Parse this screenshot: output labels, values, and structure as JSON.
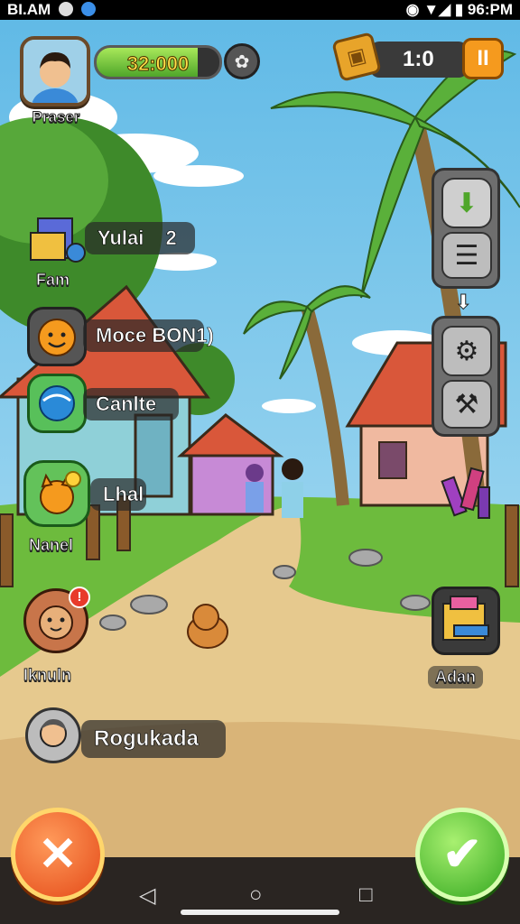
{
  "status_bar": {
    "left_text": "BI.AM",
    "right_text": "96:PM"
  },
  "hud": {
    "player_name": "Praser",
    "coins": "32:000",
    "coin_progress": 0.82,
    "timer": "1:0",
    "pause_symbol": "II"
  },
  "left_menu": [
    {
      "name": "fam",
      "icon": "books-icon",
      "label": "Yulai",
      "label_count": "2",
      "sublabel": "Fam"
    },
    {
      "name": "mode",
      "icon": "smiley-icon",
      "label": "Moce BON1)",
      "sublabel": ""
    },
    {
      "name": "candidate",
      "icon": "globe-icon",
      "label": "Canlte",
      "sublabel": ""
    },
    {
      "name": "chat",
      "icon": "cat-icon",
      "label": "Lhal",
      "sublabel": "Nanel"
    },
    {
      "name": "skill",
      "icon": "monkey-icon",
      "label": "",
      "sublabel": "Iknuln"
    },
    {
      "name": "rogukada",
      "icon": "profile-icon",
      "label": "Rogukada",
      "sublabel": ""
    }
  ],
  "right_items": {
    "adan_label": "Adan"
  },
  "colors": {
    "accent_green": "#4fa62a",
    "accent_orange": "#f59a1e",
    "sky": "#7ec8e8",
    "dirt": "#e6c98e"
  }
}
